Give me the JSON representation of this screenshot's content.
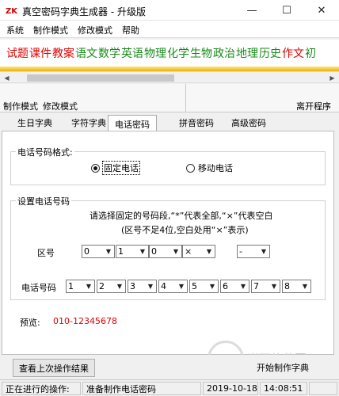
{
  "window": {
    "title": "真空密码字典生成器 - 升级版",
    "icon_text": "ZK",
    "minimize": "—",
    "maximize": "☐",
    "close": "✕"
  },
  "menu": [
    "系统",
    "制作模式",
    "修改模式",
    "帮助"
  ],
  "ad_subjects": [
    {
      "text": "试题",
      "color": "#e00000"
    },
    {
      "text": "课件",
      "color": "#e00000"
    },
    {
      "text": "教案",
      "color": "#e00000"
    },
    {
      "text": "语文",
      "color": "#1a8a1a"
    },
    {
      "text": "数学",
      "color": "#1a8a1a"
    },
    {
      "text": "英语",
      "color": "#1a8a1a"
    },
    {
      "text": "物理",
      "color": "#1a8a1a"
    },
    {
      "text": "化学",
      "color": "#1a8a1a"
    },
    {
      "text": "生物",
      "color": "#1a8a1a"
    },
    {
      "text": "政治",
      "color": "#1a8a1a"
    },
    {
      "text": "地理",
      "color": "#1a8a1a"
    },
    {
      "text": "历史",
      "color": "#1a8a1a"
    },
    {
      "text": "作文",
      "color": "#e00000"
    },
    {
      "text": "初",
      "color": "#1a8a1a"
    }
  ],
  "toolbar": {
    "make_mode": "制作模式",
    "modify_mode": "修改模式",
    "exit": "离开程序"
  },
  "tabs": [
    "生日字典",
    "字符字典",
    "电话密码",
    "拼音密码",
    "高级密码"
  ],
  "active_tab": 2,
  "format_group": {
    "title": "电话号码格式:",
    "options": [
      "固定电话",
      "移动电话"
    ],
    "selected": 0
  },
  "number_group": {
    "title": "设置电话号码",
    "instruction_line1": "请选择固定的号码段,“*”代表全部,“×”代表空白",
    "instruction_line2": "(区号不足4位,空白处用“×”表示)",
    "area_label": "区号",
    "area_values": [
      "0",
      "1",
      "0",
      "×"
    ],
    "separator_value": "-",
    "phone_label": "电话号码",
    "phone_values": [
      "1",
      "2",
      "3",
      "4",
      "5",
      "6",
      "7",
      "8"
    ]
  },
  "preview": {
    "label": "预览:",
    "value": "010-12345678"
  },
  "buttons": {
    "view_last": "查看上次操作结果",
    "start": "开始制作字典"
  },
  "status": {
    "label": "正在进行的操作:",
    "message": "准备制作电话密码",
    "date": "2019-10-18",
    "time": "14:08:51"
  },
  "watermark": {
    "text": "当下软件园"
  },
  "icons": {
    "dropdown": "▼",
    "scroll_left": "◀",
    "scroll_right": "▶"
  }
}
